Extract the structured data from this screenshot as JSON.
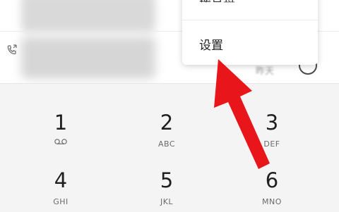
{
  "menu": {
    "item1_label": "拨号盘",
    "item2_label": "设置"
  },
  "recent": {
    "right_label": "昨天"
  },
  "dialpad": {
    "keys": [
      {
        "num": "1",
        "sub": ""
      },
      {
        "num": "2",
        "sub": "ABC"
      },
      {
        "num": "3",
        "sub": "DEF"
      },
      {
        "num": "4",
        "sub": "GHI"
      },
      {
        "num": "5",
        "sub": "JKL"
      },
      {
        "num": "6",
        "sub": "MNO"
      }
    ]
  },
  "colors": {
    "arrow": "#e8151b",
    "dialpad_bg": "#f4f4f4",
    "menu_bg": "#ffffff"
  },
  "icons": [
    "call-log-icon",
    "voicemail-icon",
    "circle-action-icon"
  ]
}
